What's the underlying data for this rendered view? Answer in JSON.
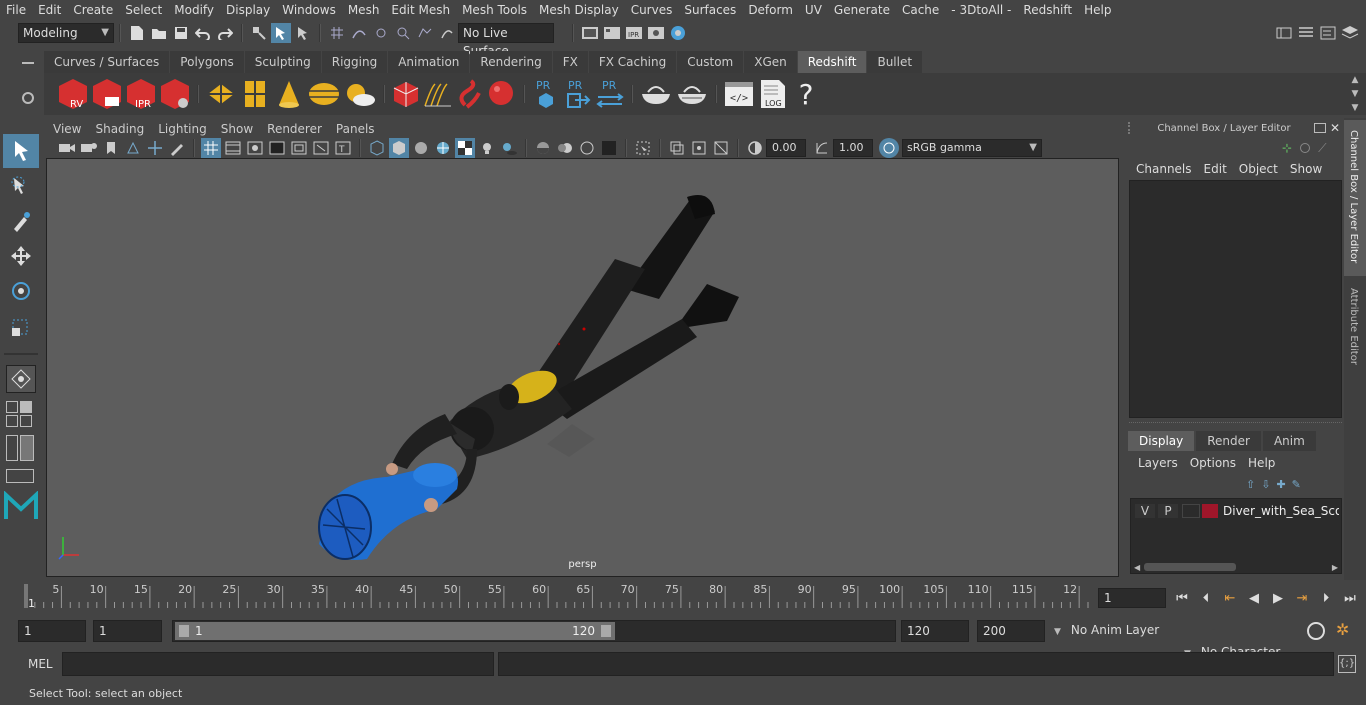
{
  "menubar": [
    "File",
    "Edit",
    "Create",
    "Select",
    "Modify",
    "Display",
    "Windows",
    "Mesh",
    "Edit Mesh",
    "Mesh Tools",
    "Mesh Display",
    "Curves",
    "Surfaces",
    "Deform",
    "UV",
    "Generate",
    "Cache",
    "- 3DtoAll -",
    "Redshift",
    "Help"
  ],
  "statusline": {
    "mode": "Modeling",
    "live_surface": "No Live Surface"
  },
  "shelf_tabs": [
    "Curves / Surfaces",
    "Polygons",
    "Sculpting",
    "Rigging",
    "Animation",
    "Rendering",
    "FX",
    "FX Caching",
    "Custom",
    "XGen",
    "Redshift",
    "Bullet"
  ],
  "shelf_active": "Redshift",
  "shelf_labels": {
    "rv": "RV",
    "ipr": "IPR",
    "pr": "PR",
    "log": "LOG",
    "help": "?"
  },
  "viewport": {
    "menu": [
      "View",
      "Shading",
      "Lighting",
      "Show",
      "Renderer",
      "Panels"
    ],
    "exposure": "0.00",
    "gamma": "1.00",
    "color_space": "sRGB gamma",
    "camera": "persp"
  },
  "channel_box": {
    "title": "Channel Box / Layer Editor",
    "menu": [
      "Channels",
      "Edit",
      "Object",
      "Show"
    ],
    "layer_tabs": [
      "Display",
      "Render",
      "Anim"
    ],
    "layer_tab_active": "Display",
    "layer_menu": [
      "Layers",
      "Options",
      "Help"
    ],
    "layer": {
      "v": "V",
      "p": "P",
      "name": "Diver_with_Sea_Scooter",
      "color": "#a0162a"
    }
  },
  "side_tabs": [
    "Channel Box / Layer Editor",
    "Attribute Editor"
  ],
  "timeline": {
    "ticks": [
      "5",
      "10",
      "15",
      "20",
      "25",
      "30",
      "35",
      "40",
      "45",
      "50",
      "55",
      "60",
      "65",
      "70",
      "75",
      "80",
      "85",
      "90",
      "95",
      "100",
      "105",
      "110",
      "115",
      "12"
    ],
    "start_label": "1",
    "current_frame": "1"
  },
  "range": {
    "start": "1",
    "start2": "1",
    "slider_start": "1",
    "slider_end": "120",
    "end": "120",
    "end2": "200",
    "anim_layer": "No Anim Layer",
    "char_set": "No Character Set"
  },
  "cmdline": {
    "lang": "MEL"
  },
  "helpline": "Select Tool: select an object",
  "colors": {
    "redshift_red": "#d63030",
    "accent_blue": "#4aa0d8",
    "yellow": "#e8b020"
  }
}
